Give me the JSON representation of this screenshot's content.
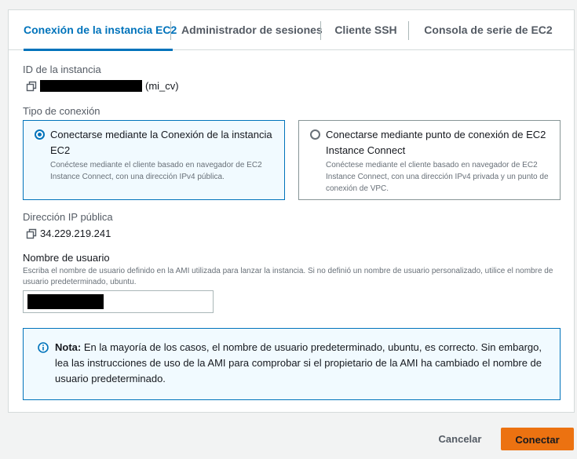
{
  "tabs": [
    {
      "label": "Conexión de la instancia EC2",
      "active": true
    },
    {
      "label": "Administrador de sesiones",
      "active": false
    },
    {
      "label": "Cliente SSH",
      "active": false
    },
    {
      "label": "Consola de serie de EC2",
      "active": false
    }
  ],
  "instance": {
    "label": "ID de la instancia",
    "name_suffix": "(mi_cv)"
  },
  "connection_type": {
    "label": "Tipo de conexión",
    "options": [
      {
        "title": "Conectarse mediante la Conexión de la instancia EC2",
        "description": "Conéctese mediante el cliente basado en navegador de EC2 Instance Connect, con una dirección IPv4 pública.",
        "selected": true
      },
      {
        "title": "Conectarse mediante punto de conexión de EC2 Instance Connect",
        "description": "Conéctese mediante el cliente basado en navegador de EC2 Instance Connect, con una dirección IPv4 privada y un punto de conexión de VPC.",
        "selected": false
      }
    ]
  },
  "public_ip": {
    "label": "Dirección IP pública",
    "value": "34.229.219.241"
  },
  "username": {
    "label": "Nombre de usuario",
    "hint": "Escriba el nombre de usuario definido en la AMI utilizada para lanzar la instancia. Si no definió un nombre de usuario personalizado, utilice el nombre de usuario predeterminado, ubuntu."
  },
  "note": {
    "prefix": "Nota:",
    "text": " En la mayoría de los casos, el nombre de usuario predeterminado, ubuntu, es correcto. Sin embargo, lea las instrucciones de uso de la AMI para comprobar si el propietario de la AMI ha cambiado el nombre de usuario predeterminado."
  },
  "actions": {
    "cancel": "Cancelar",
    "connect": "Conectar"
  },
  "colors": {
    "accent": "#0073bb",
    "primary_button": "#ec7211"
  },
  "icons": {
    "copy": "copy-icon",
    "info": "info-icon"
  }
}
